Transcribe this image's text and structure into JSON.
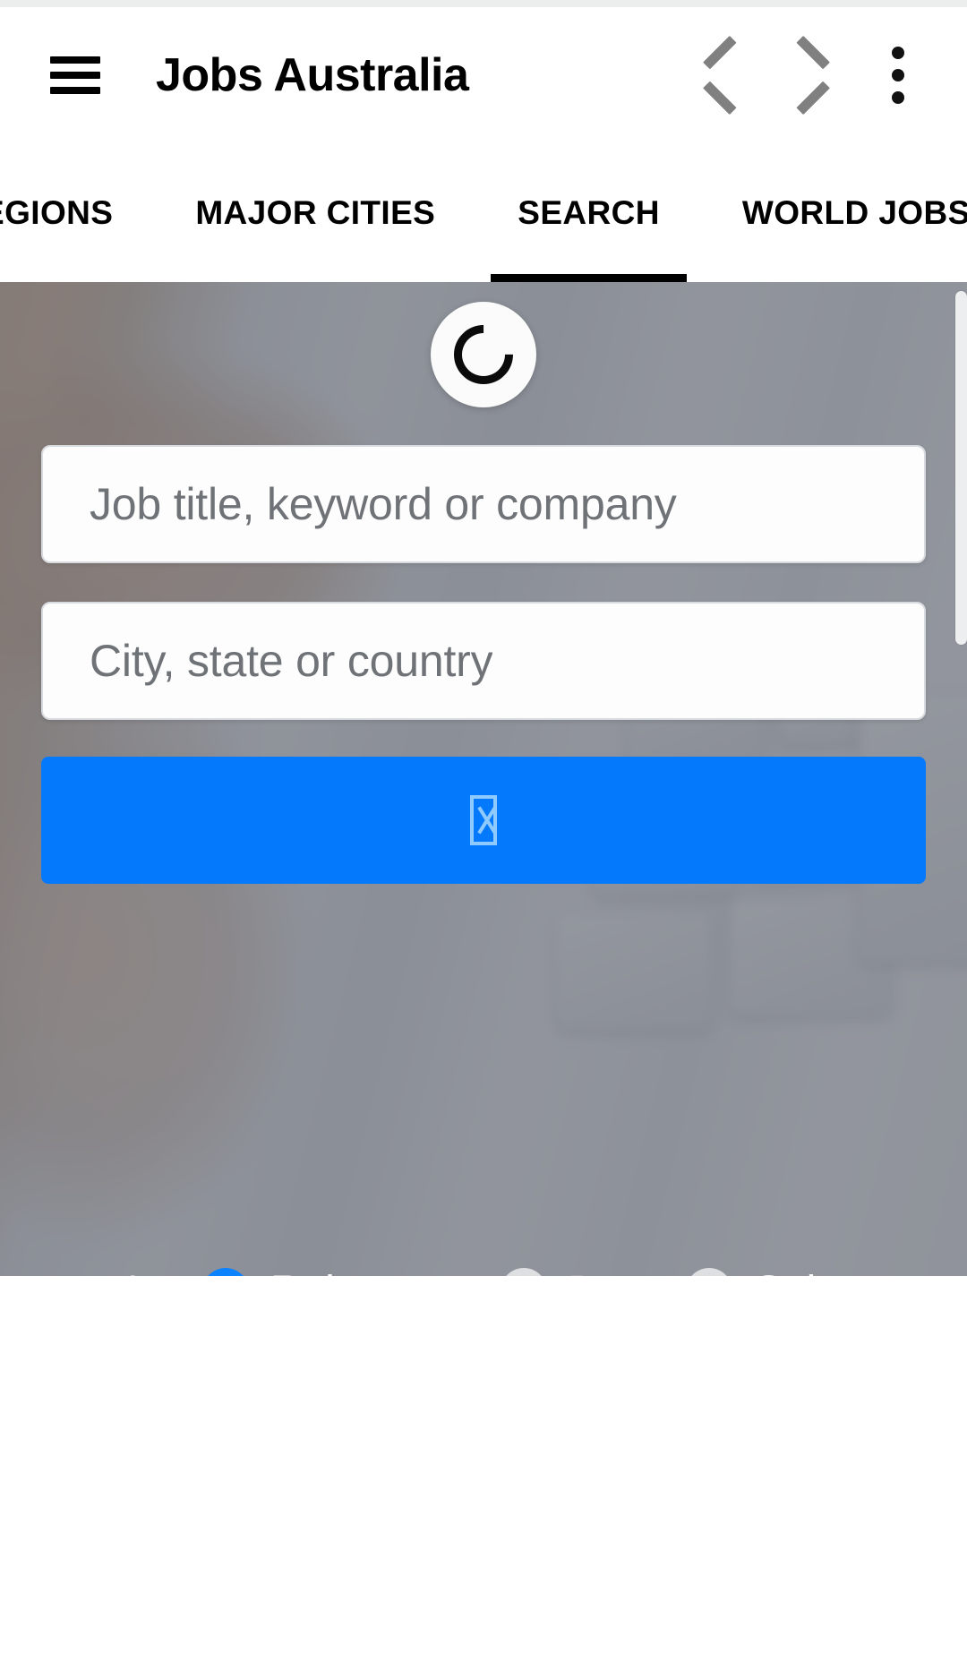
{
  "app": {
    "title": "Jobs Australia",
    "accent_blue": "#0579fc",
    "radio_blue": "#0b82fe",
    "overlay_gray": "#5a606a",
    "placeholder_gray": "#6f7377",
    "chevron_gray": "#808080"
  },
  "appbar": {
    "menu_icon": "hamburger-menu-icon",
    "title": "Jobs Australia",
    "back_icon": "chevron-left-icon",
    "forward_icon": "chevron-right-icon",
    "overflow_icon": "kebab-menu-icon"
  },
  "tabbar": {
    "tabs": [
      {
        "label": "EGIONS",
        "active": false
      },
      {
        "label": "MAJOR CITIES",
        "active": false
      },
      {
        "label": "SEARCH",
        "active": true
      },
      {
        "label": "WORLD JOBS",
        "active": false
      }
    ]
  },
  "hero": {
    "spinner_icon": "loading-spinner-icon",
    "keyword_field": {
      "value": "",
      "placeholder": "Job title, keyword or company"
    },
    "location_field": {
      "value": "",
      "placeholder": "City, state or country"
    },
    "search_button": {
      "label": "▯",
      "icon": "missing-glyph-tofu-icon"
    },
    "sort": {
      "label": "Sort by",
      "options": [
        {
          "label": "Relevance",
          "selected": true
        },
        {
          "label": "Date",
          "selected": false
        },
        {
          "label": "Salary",
          "selected": false
        }
      ]
    }
  },
  "scrollbar": {
    "name": "vertical-scrollbar"
  }
}
